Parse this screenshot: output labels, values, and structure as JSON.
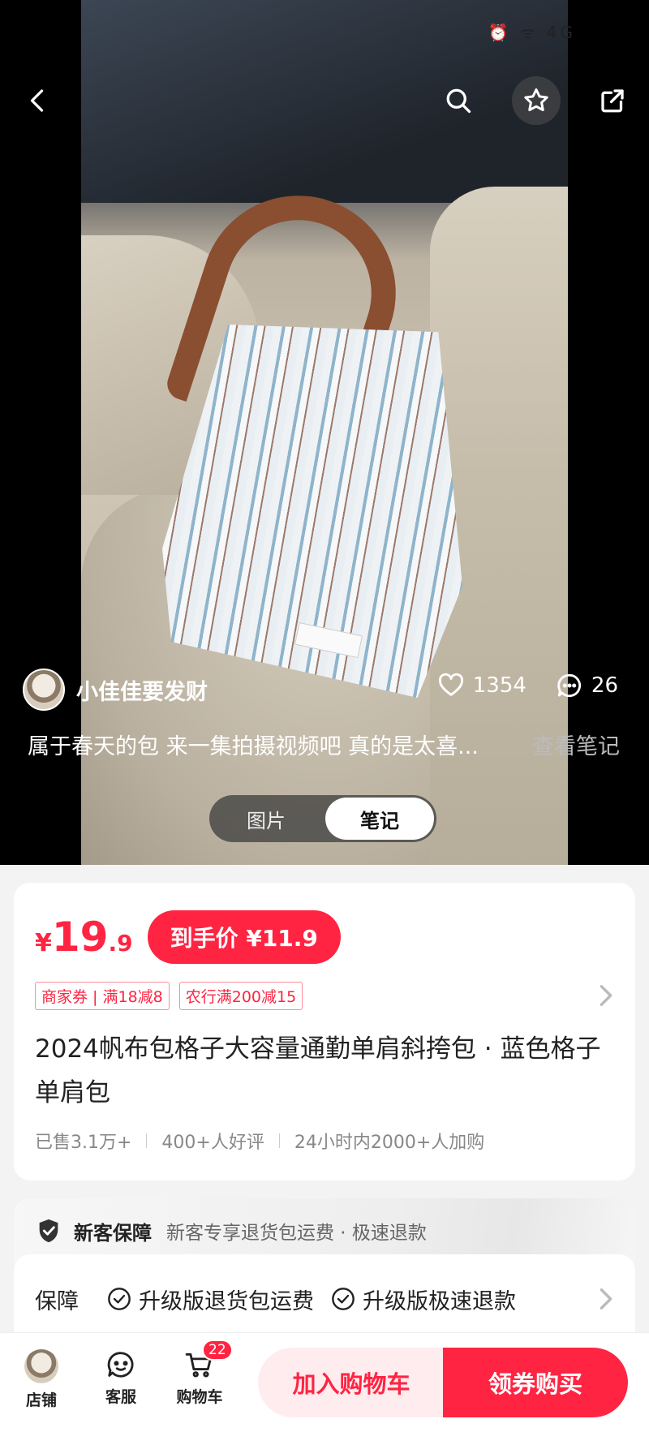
{
  "status_bar": {
    "indicators": "⏰ ᯤ 4G"
  },
  "note": {
    "author": "小佳佳要发财",
    "likes": "1354",
    "comments": "26",
    "caption": "属于春天的包 来一集拍摄视频吧 真的是太喜...",
    "view_note": "查看笔记",
    "tabs": [
      "图片",
      "笔记"
    ],
    "active_tab": "笔记"
  },
  "product": {
    "currency": "¥",
    "price_int": "19",
    "price_dec": ".9",
    "deal_price": "到手价 ¥11.9",
    "coupons": [
      "商家券 | 满18减8",
      "农行满200减15"
    ],
    "title": "2024帆布包格子大容量通勤单肩斜挎包 · 蓝色格子单肩包",
    "sales": [
      "已售3.1万+",
      "400+人好评",
      "24小时内2000+人加购"
    ]
  },
  "guarantee": {
    "title": "新客保障",
    "desc": "新客专享退货包运费 · 极速退款"
  },
  "protection": {
    "label": "保障",
    "items": [
      "升级版退货包运费",
      "升级版极速退款"
    ]
  },
  "bottom_bar": {
    "shop": "店铺",
    "service": "客服",
    "cart": "购物车",
    "cart_count": "22",
    "add_to_cart": "加入购物车",
    "buy": "领券购买"
  },
  "colors": {
    "accent": "#ff2442",
    "accent_light": "#ffecef"
  }
}
